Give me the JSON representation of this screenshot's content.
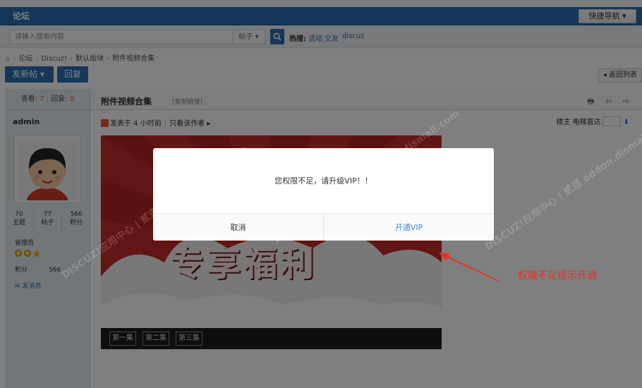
{
  "nav": {
    "tab": "论坛",
    "quick_nav": "快捷导航 ▾"
  },
  "search": {
    "placeholder": "请输入搜索内容",
    "type": "帖子 ▾",
    "hot_label": "热搜:",
    "hot_links": [
      "活动",
      "交友",
      "discuz"
    ]
  },
  "breadcrumb": [
    "论坛",
    "Discuz!",
    "默认版块",
    "附件视频合集"
  ],
  "actions": {
    "new_post": "发新帖 ▾",
    "reply": "回复",
    "back": "◂ 返回列表"
  },
  "thread_stats": {
    "views_label": "查看:",
    "views": "7",
    "replies_label": "回复:",
    "replies": "0"
  },
  "post": {
    "title": "附件视频合集",
    "copy_link": "[复制链接]",
    "header_icons": "🖶 ⇦ ⇨",
    "posted": "发表于 4 小时前",
    "only_author": "只看该作者 ▸",
    "floor": "楼主",
    "jump_label": "电梯直达",
    "banner_text": "专享福利",
    "episodes": [
      "第一集",
      "第二集",
      "第三集"
    ]
  },
  "author": {
    "name": "admin",
    "stats": [
      {
        "value": "70",
        "label": "主题"
      },
      {
        "value": "77",
        "label": "帖子"
      },
      {
        "value": "566",
        "label": "积分"
      }
    ],
    "role": "管理员",
    "points_label": "积分",
    "points": "566",
    "send_msg": "✉ 发消息"
  },
  "modal": {
    "message": "您权限不足，请升级VIP！！",
    "cancel": "取消",
    "confirm": "开通VIP"
  },
  "watermark": "DISCUZ!应用中心 | 贰道 addon.dismall.com",
  "annotation": "权限不足提示开通",
  "colors": {
    "primary": "#2b6fb2",
    "annotation": "#e8322a",
    "vip_link": "#3d8bd6"
  }
}
